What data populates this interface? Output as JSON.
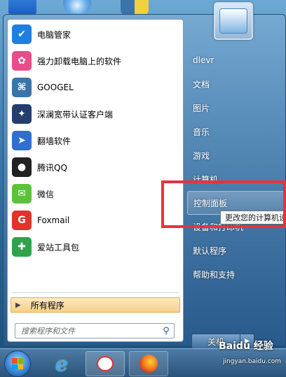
{
  "left_pane": {
    "programs": [
      {
        "label": "电脑管家",
        "icon": "tencent-pc-manager-icon",
        "color": "#1f7fe0",
        "glyph": "✔"
      },
      {
        "label": "强力卸载电脑上的软件",
        "icon": "uninstaller-icon",
        "color": "#e84c8a",
        "glyph": "✿"
      },
      {
        "label": "GOOGEL",
        "icon": "python-icon",
        "color": "#3b74a8",
        "glyph": "⌘"
      },
      {
        "label": "深澜宽带认证客户端",
        "icon": "broadband-client-icon",
        "color": "#233d6e",
        "glyph": "✦"
      },
      {
        "label": "翻墙软件",
        "icon": "vpn-software-icon",
        "color": "#2e6fd1",
        "glyph": "➤"
      },
      {
        "label": "腾讯QQ",
        "icon": "qq-penguin-icon",
        "color": "#222222",
        "glyph": "●"
      },
      {
        "label": "微信",
        "icon": "wechat-icon",
        "color": "#5cc23a",
        "glyph": "✉"
      },
      {
        "label": "Foxmail",
        "icon": "foxmail-icon",
        "color": "#e0332b",
        "glyph": "G"
      },
      {
        "label": "爱站工具包",
        "icon": "aizhan-toolkit-icon",
        "color": "#2fa34a",
        "glyph": "✚"
      }
    ],
    "all_programs": "所有程序",
    "search_placeholder": "搜索程序和文件"
  },
  "right_pane": {
    "items": [
      {
        "label": "dlevr",
        "highlight": false
      },
      {
        "label": "文档",
        "highlight": false
      },
      {
        "label": "图片",
        "highlight": false
      },
      {
        "label": "音乐",
        "highlight": false
      },
      {
        "label": "游戏",
        "highlight": false
      },
      {
        "label": "计算机",
        "highlight": false
      },
      {
        "label": "控制面板",
        "highlight": true
      },
      {
        "label": "设备和打印机",
        "highlight": false
      },
      {
        "label": "默认程序",
        "highlight": false
      },
      {
        "label": "帮助和支持",
        "highlight": false
      }
    ],
    "tooltip": "更改您的计算机设置",
    "shutdown": "关机"
  },
  "watermark": {
    "brand": "Baidu 经验",
    "url": "jingyan.baidu.com"
  },
  "colors": {
    "highlight_box": "#e8323c",
    "all_programs_bg": "#f7cf8b"
  }
}
